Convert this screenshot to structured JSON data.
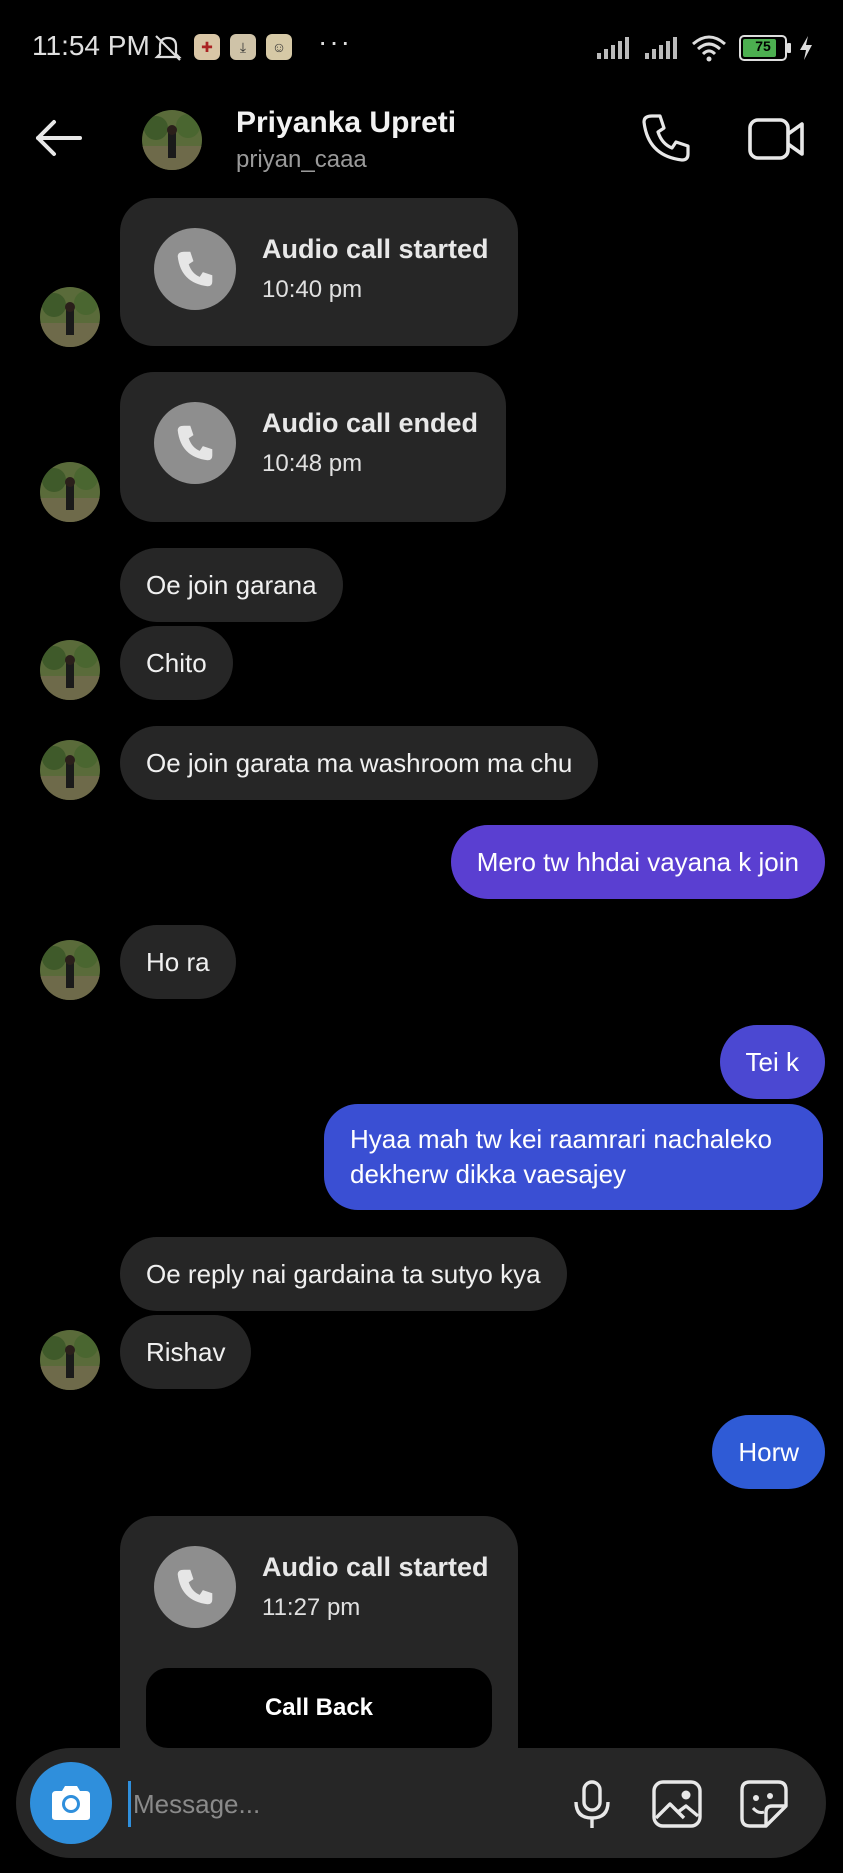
{
  "status_bar": {
    "time": "11:54 PM",
    "battery": "75"
  },
  "header": {
    "name": "Priyanka Upreti",
    "username": "priyan_caaa"
  },
  "messages": {
    "call1": {
      "title": "Audio call started",
      "time": "10:40 pm"
    },
    "call2": {
      "title": "Audio call ended",
      "time": "10:48 pm"
    },
    "m1": "Oe join garana",
    "m2": "Chito",
    "m3": "Oe join garata ma washroom ma chu",
    "m4": "Mero tw hhdai vayana k join",
    "m5": "Ho ra",
    "m6": "Tei k",
    "m7": "Hyaa mah tw kei raamrari nachaleko dekherw dikka vaesajey",
    "m8": "Oe reply nai gardaina ta sutyo kya",
    "m9": "Rishav",
    "m10": "Horw",
    "call3": {
      "title": "Audio call started",
      "time": "11:27 pm",
      "button": "Call Back"
    }
  },
  "composer": {
    "placeholder": "Message..."
  },
  "colors": {
    "incoming_bubble": "#262626",
    "outgoing_purple": "#5a3fd1",
    "outgoing_blue": "#2f5bd6",
    "camera_button": "#2f8fdc"
  },
  "icons": {
    "back": "arrow-left",
    "call": "phone",
    "video": "video-camera",
    "camera": "camera",
    "mic": "microphone",
    "gallery": "image",
    "sticker": "sticker"
  }
}
